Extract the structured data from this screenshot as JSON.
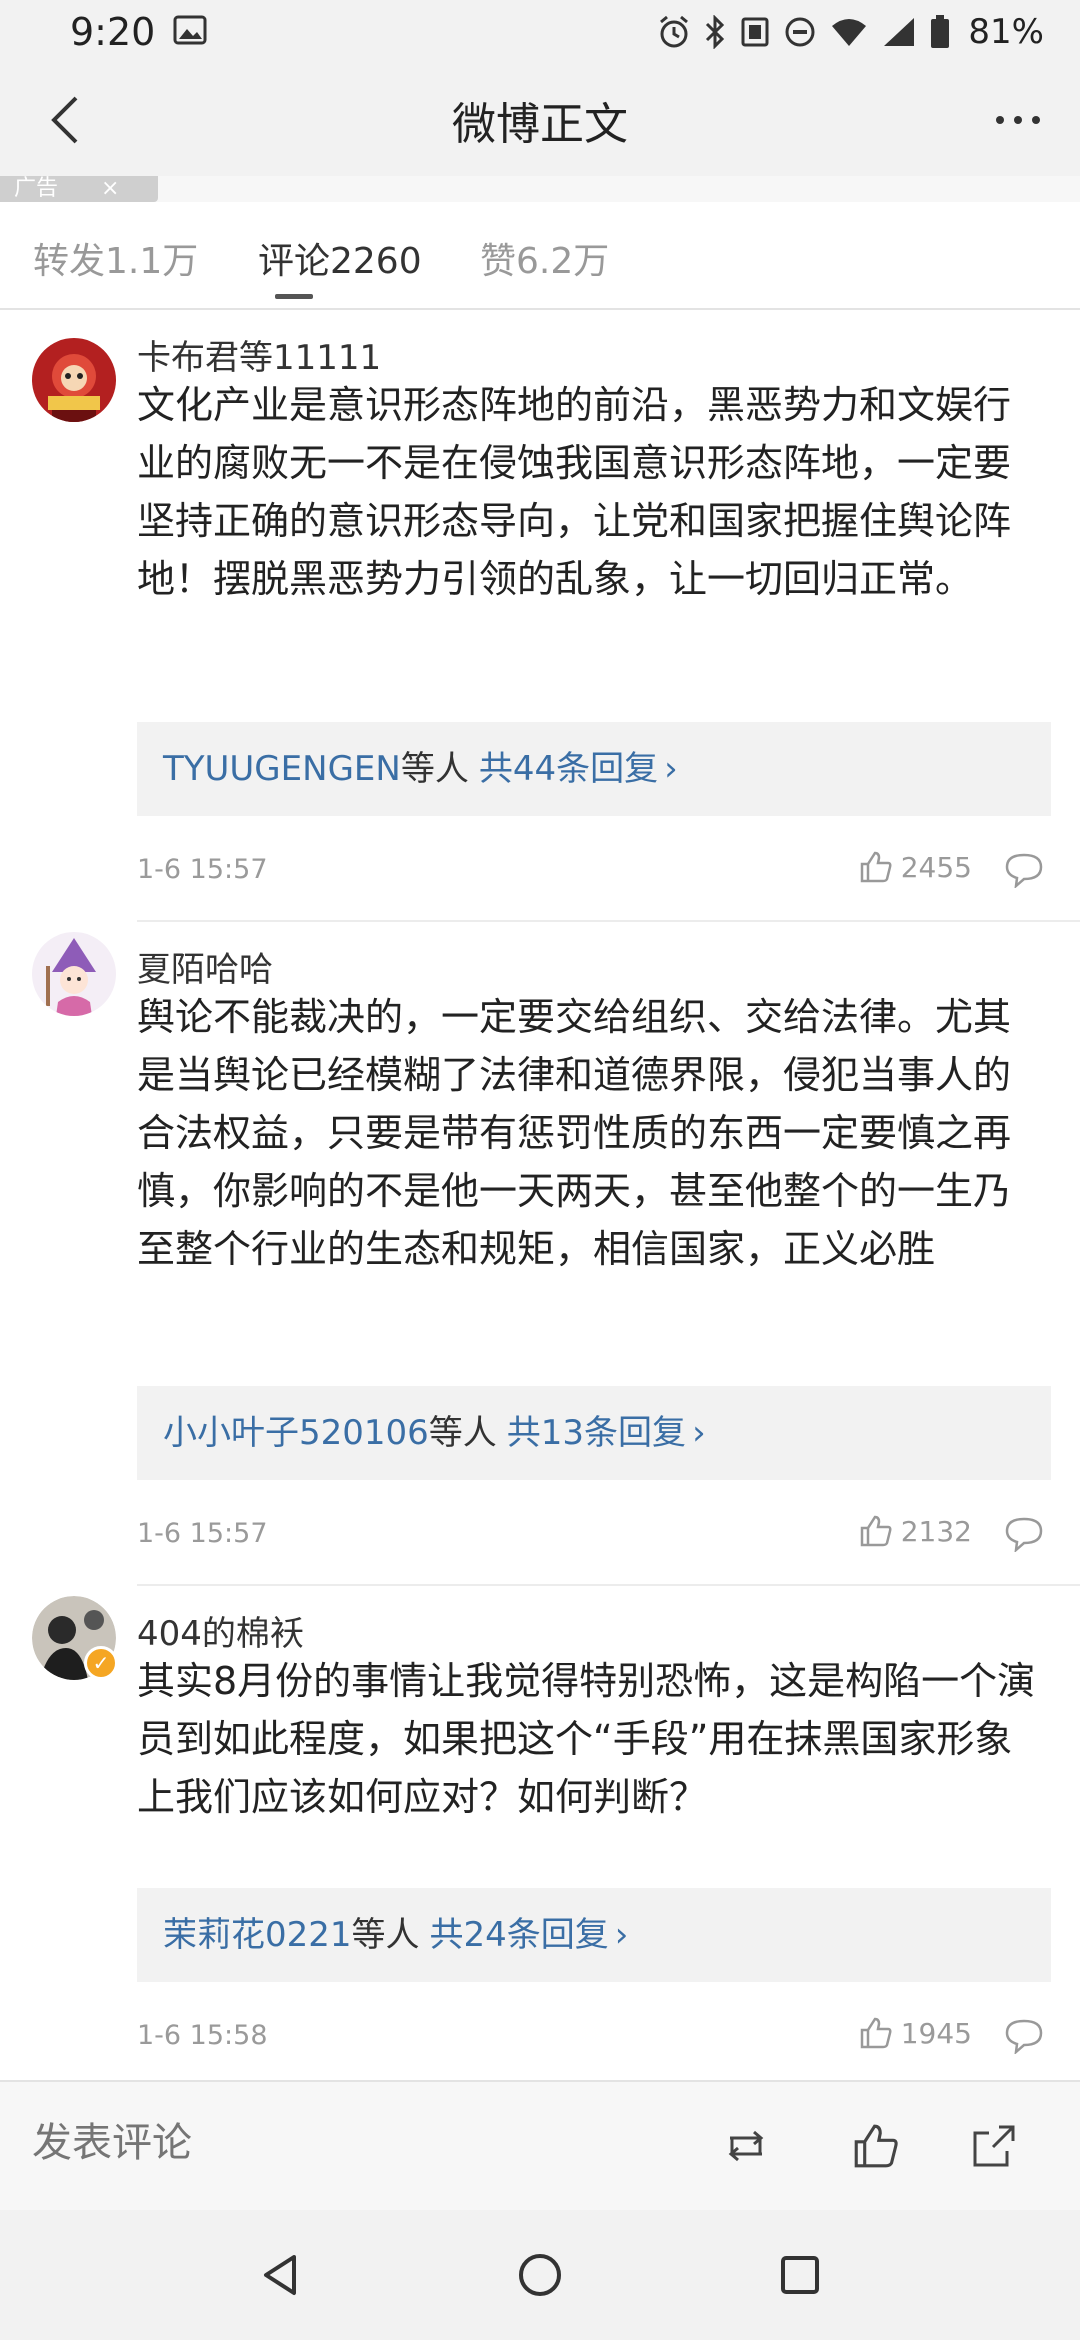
{
  "status_bar": {
    "time": "9:20",
    "battery": "81%"
  },
  "nav": {
    "title": "微博正文"
  },
  "ad": {
    "label": "广告"
  },
  "tabs": [
    {
      "label": "转发1.1万",
      "active": false
    },
    {
      "label": "评论2260",
      "active": true
    },
    {
      "label": "赞6.2万",
      "active": false
    }
  ],
  "comments": [
    {
      "user": "卡布君等11111",
      "text": "文化产业是意识形态阵地的前沿，黑恶势力和文娱行业的腐败无一不是在侵蚀我国意识形态阵地，一定要坚持正确的意识形态导向，让党和国家把握住舆论阵地！摆脱黑恶势力引领的乱象，让一切回归正常。",
      "reply_names": "TYUUGENGEN",
      "reply_suffix": "等人",
      "reply_count": "共44条回复",
      "time": "1-6 15:57",
      "likes": "2455"
    },
    {
      "user": "夏陌哈哈",
      "text": "舆论不能裁决的，一定要交给组织、交给法律。尤其是当舆论已经模糊了法律和道德界限，侵犯当事人的合法权益，只要是带有惩罚性质的东西一定要慎之再慎，你影响的不是他一天两天，甚至他整个的一生乃至整个行业的生态和规矩，相信国家，正义必胜",
      "reply_names": "小小叶子520106",
      "reply_suffix": "等人",
      "reply_count": "共13条回复",
      "time": "1-6 15:57",
      "likes": "2132"
    },
    {
      "user": "404的棉袄",
      "text": "其实8月份的事情让我觉得特别恐怖，这是构陷一个演员到如此程度，如果把这个“手段”用在抹黑国家形象上我们应该如何应对？如何判断？",
      "reply_names": "茉莉花0221",
      "reply_suffix": "等人",
      "reply_count": "共24条回复",
      "time": "1-6 15:58",
      "likes": "1945"
    }
  ],
  "bottom_bar": {
    "compose_placeholder": "发表评论"
  },
  "colors": {
    "link": "#3a6ea5",
    "muted": "#9a9a9a",
    "verified_badge": "#f5a623"
  }
}
